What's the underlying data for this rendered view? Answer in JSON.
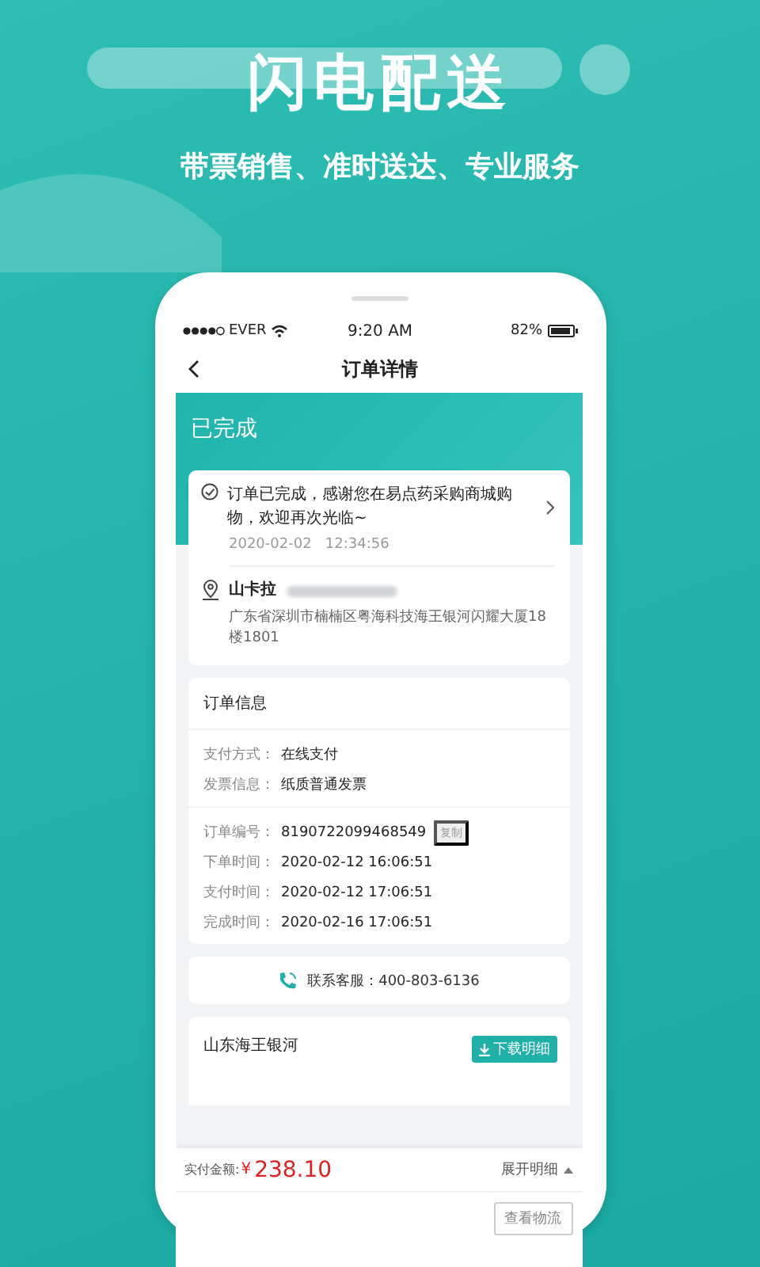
{
  "promo": {
    "title": "闪电配送",
    "subtitle": "带票销售、准时送达、专业服务"
  },
  "status_bar": {
    "carrier": "EVER",
    "time": "9:20 AM",
    "battery": "82%"
  },
  "nav": {
    "title": "订单详情"
  },
  "order_status": "已完成",
  "status_card": {
    "message": "订单已完成，感谢您在易点药采购商城购物，欢迎再次光临~",
    "time": "2020-02-02   12:34:56"
  },
  "address": {
    "name": "山卡拉",
    "address": "广东省深圳市楠楠区粤海科技海王银河闪耀大厦18楼1801"
  },
  "order_info": {
    "title": "订单信息",
    "groups": [
      [
        {
          "label": "支付方式：",
          "value": "在线支付"
        },
        {
          "label": "发票信息：",
          "value": "纸质普通发票"
        }
      ],
      [
        {
          "label": "订单编号：",
          "value": "8190722099468549",
          "action": "复制"
        },
        {
          "label": "下单时间：",
          "value": "2020-02-12 16:06:51"
        },
        {
          "label": "支付时间：",
          "value": "2020-02-12 17:06:51"
        },
        {
          "label": "完成时间：",
          "value": "2020-02-16 17:06:51"
        }
      ]
    ]
  },
  "contact": {
    "text": "联系客服：400-803-6136"
  },
  "store": {
    "name": "山东海王银河",
    "button": "下载明细"
  },
  "footer": {
    "total_label": "实付金额:",
    "currency": "¥",
    "total": "238.10",
    "expand": "展开明细",
    "logistics": "查看物流"
  }
}
